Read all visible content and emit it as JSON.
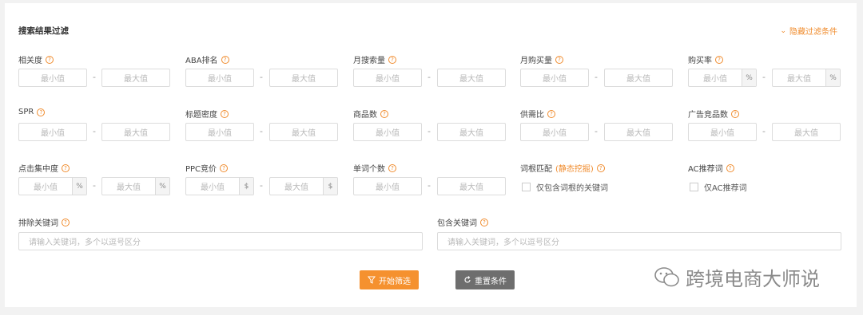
{
  "header": {
    "title": "搜索结果过滤",
    "hide_label": "隐藏过滤条件",
    "hide_icon": "chevron-down-icon"
  },
  "placeholders": {
    "min": "最小值",
    "max": "最大值"
  },
  "units": {
    "percent": "%",
    "dollar": "$"
  },
  "filters": {
    "relevance": "相关度",
    "aba_rank": "ABA排名",
    "monthly_search": "月搜索量",
    "monthly_purchase": "月购买量",
    "purchase_rate": "购买率",
    "spr": "SPR",
    "title_density": "标题密度",
    "product_count": "商品数",
    "supply_demand": "供需比",
    "ad_product_count": "广告竞品数",
    "click_concentration": "点击集中度",
    "ppc_bid": "PPC竞价",
    "word_count": "单词个数",
    "root_match": "词根匹配",
    "root_match_link": "(静态挖掘)",
    "root_match_option": "仅包含词根的关键词",
    "ac_recommend": "AC推荐词",
    "ac_recommend_option": "仅AC推荐词",
    "exclude_keywords": "排除关键词",
    "include_keywords": "包含关键词"
  },
  "keyword_placeholder": "请输入关键词，多个以逗号区分",
  "buttons": {
    "start": "开始筛选",
    "reset": "重置条件"
  },
  "watermark": "跨境电商大师说",
  "colors": {
    "accent": "#f08c2e",
    "reset": "#6e6e6e"
  }
}
